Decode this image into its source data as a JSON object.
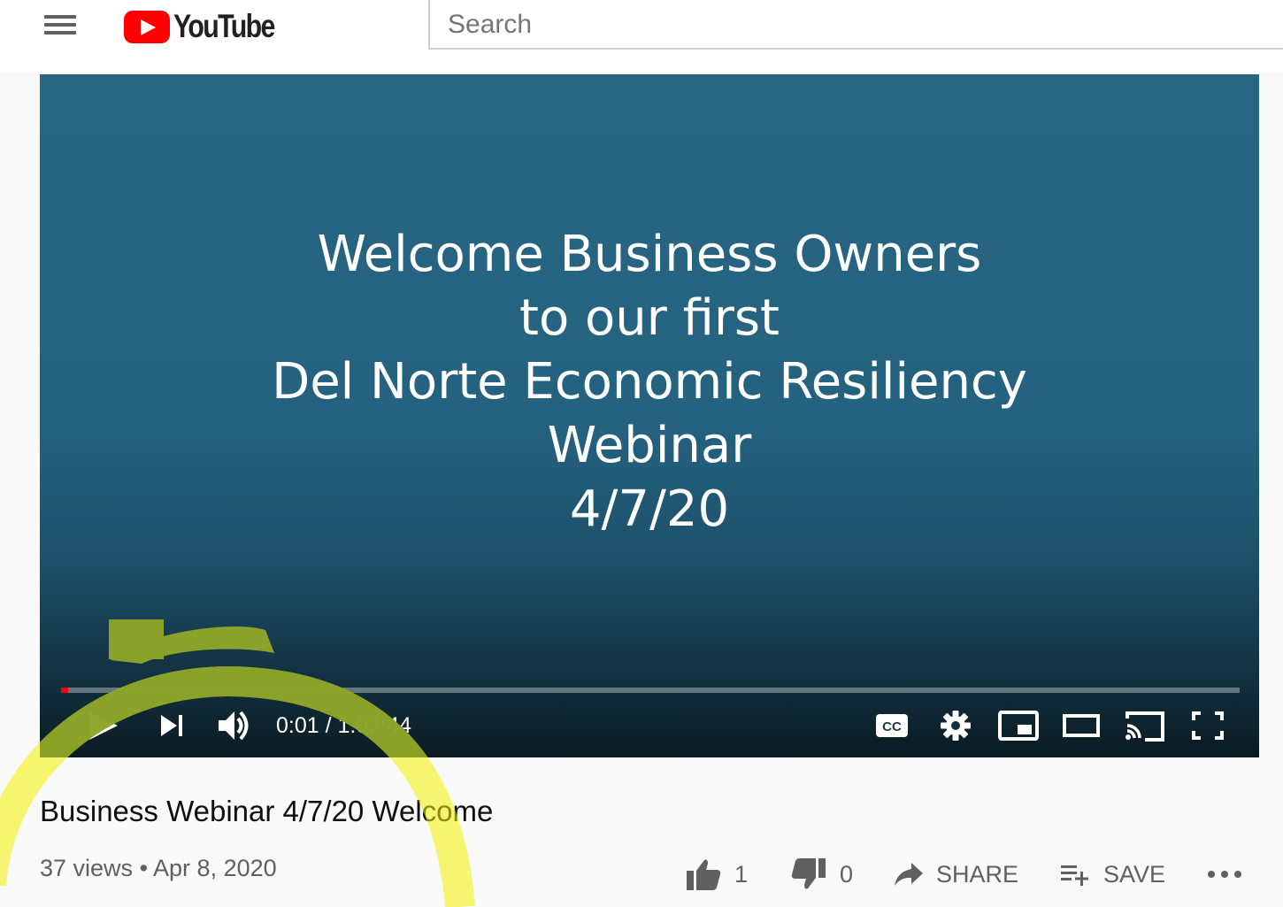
{
  "header": {
    "logo_text": "YouTube",
    "search_placeholder": "Search"
  },
  "player": {
    "slide_lines": [
      "Welcome Business Owners",
      "to our first",
      "Del Norte Economic Resiliency",
      "Webinar",
      "4/7/20"
    ],
    "current_time": "0:01",
    "separator": " / ",
    "duration": "1:02:44",
    "progress_fraction": 0.0003,
    "slide_bg": "#276683"
  },
  "video": {
    "title": "Business Webinar 4/7/20 Welcome",
    "views": "37 views",
    "dot": "•",
    "date": "Apr 8, 2020"
  },
  "actions": {
    "like_count": "1",
    "dislike_count": "0",
    "share_label": "SHARE",
    "save_label": "SAVE"
  },
  "colors": {
    "brand_red": "#ff0000",
    "annotation_yellow": "#f2f200",
    "annotation_olive": "#8aa22a"
  }
}
